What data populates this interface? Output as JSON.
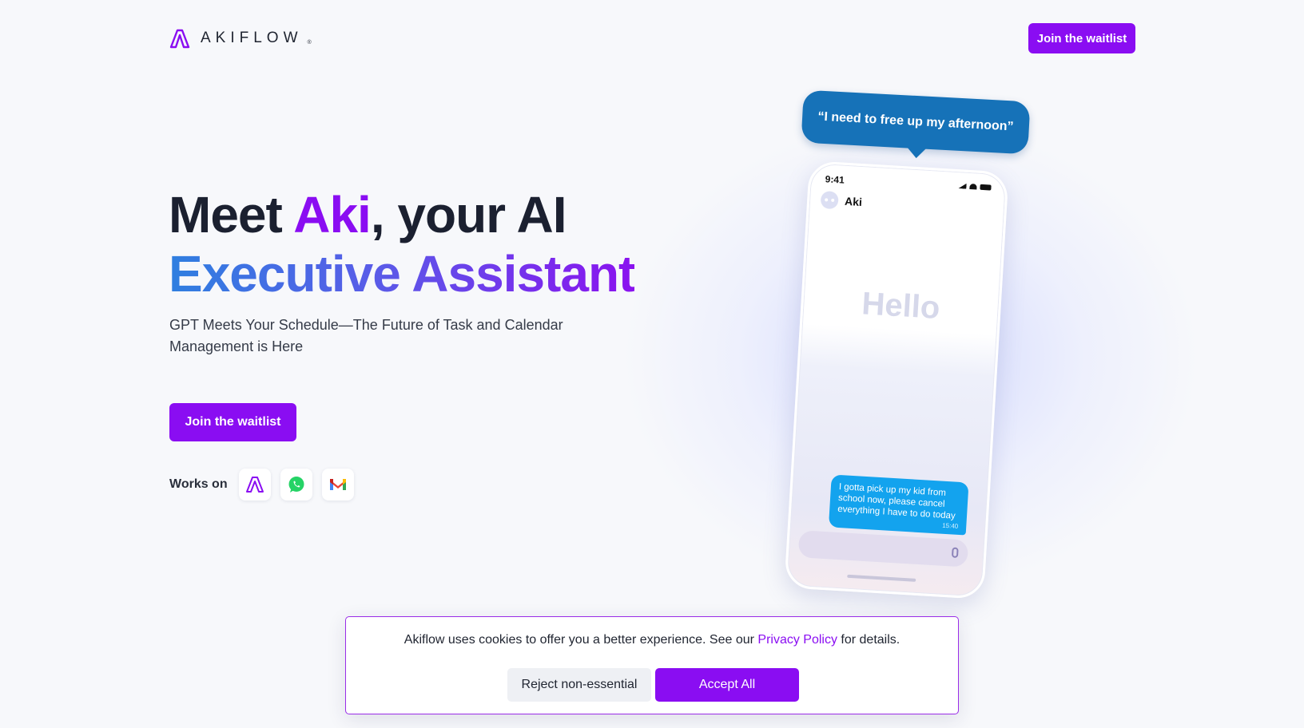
{
  "brand": {
    "name": "AKIFLOW",
    "registered_mark": "®",
    "color": "#8a0df2"
  },
  "nav": {
    "cta_label": "Join the waitlist"
  },
  "hero": {
    "headline_part1": "Meet ",
    "headline_highlight": "Aki",
    "headline_part2": ", your AI",
    "headline_line2": "Executive Assistant",
    "subtitle": "GPT Meets Your Schedule—The Future of Task and Calendar Management is Here",
    "cta_label": "Join the waitlist",
    "works_on_label": "Works on",
    "works_on_icons": [
      "akiflow-icon",
      "whatsapp-icon",
      "gmail-icon"
    ]
  },
  "phone": {
    "speech_bubble": "“I need to free up my afternoon”",
    "status_time": "9:41",
    "chat_name": "Aki",
    "hello_text": "Hello",
    "message_text": "I gotta pick up my kid from school now, please cancel everything I have to do today",
    "message_time": "15:40"
  },
  "cookie_banner": {
    "text_before": "Akiflow uses cookies to offer you a better experience. See our ",
    "link_label": "Privacy Policy",
    "text_after": " for details.",
    "reject_label": "Reject non-essential",
    "accept_label": "Accept All"
  }
}
